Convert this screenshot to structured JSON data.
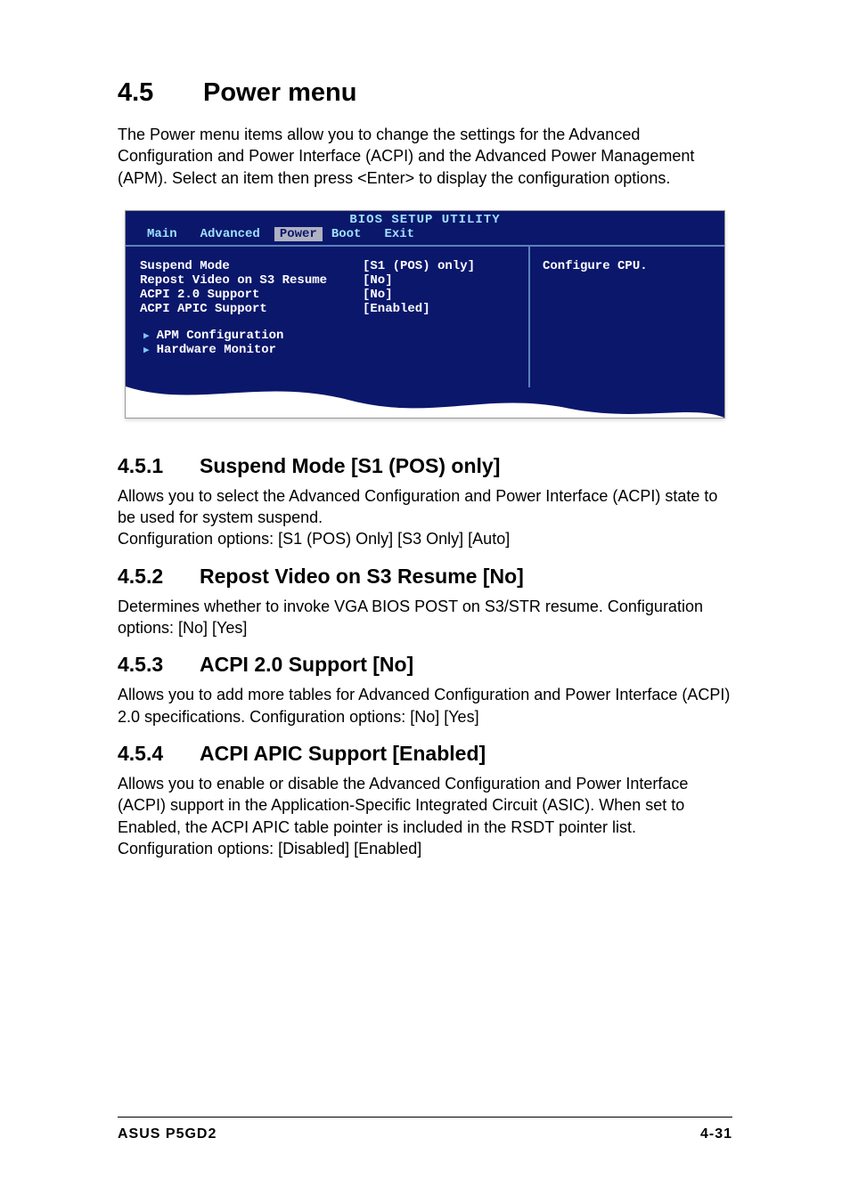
{
  "heading": {
    "num": "4.5",
    "title": "Power menu"
  },
  "intro": "The Power menu items allow you to change the settings for the Advanced Configuration and Power Interface (ACPI) and the Advanced Power Management (APM). Select an item then press <Enter> to display the configuration options.",
  "bios": {
    "title": "BIOS SETUP UTILITY",
    "tabs": [
      "Main",
      "Advanced",
      "Power",
      "Boot",
      "Exit"
    ],
    "active_tab": "Power",
    "rows": [
      {
        "label": "Suspend Mode",
        "value": "[S1 (POS) only]"
      },
      {
        "label": "Repost Video on S3 Resume",
        "value": "[No]"
      },
      {
        "label": "ACPI 2.0 Support",
        "value": "[No]"
      },
      {
        "label": "ACPI APIC Support",
        "value": "[Enabled]"
      }
    ],
    "subs": [
      "APM Configuration",
      "Hardware Monitor"
    ],
    "help": "Configure CPU."
  },
  "sections": [
    {
      "num": "4.5.1",
      "title": "Suspend Mode [S1 (POS) only]",
      "body": "Allows you to select the Advanced Configuration and Power Interface (ACPI) state to be used for system suspend.\nConfiguration options: [S1 (POS) Only] [S3 Only] [Auto]"
    },
    {
      "num": "4.5.2",
      "title": "Repost Video on S3 Resume [No]",
      "body": "Determines whether to invoke VGA BIOS POST on S3/STR resume. Configuration options: [No] [Yes]"
    },
    {
      "num": "4.5.3",
      "title": "ACPI 2.0 Support [No]",
      "body": "Allows you to add more tables for Advanced Configuration and Power Interface (ACPI) 2.0 specifications. Configuration options: [No] [Yes]"
    },
    {
      "num": "4.5.4",
      "title": "ACPI APIC Support [Enabled]",
      "body": "Allows you to enable or disable the Advanced Configuration and Power Interface (ACPI) support in the Application-Specific Integrated Circuit (ASIC). When set to Enabled, the ACPI APIC table pointer is included in the RSDT pointer list. Configuration options: [Disabled] [Enabled]"
    }
  ],
  "footer": {
    "left": "ASUS P5GD2",
    "right": "4-31"
  }
}
